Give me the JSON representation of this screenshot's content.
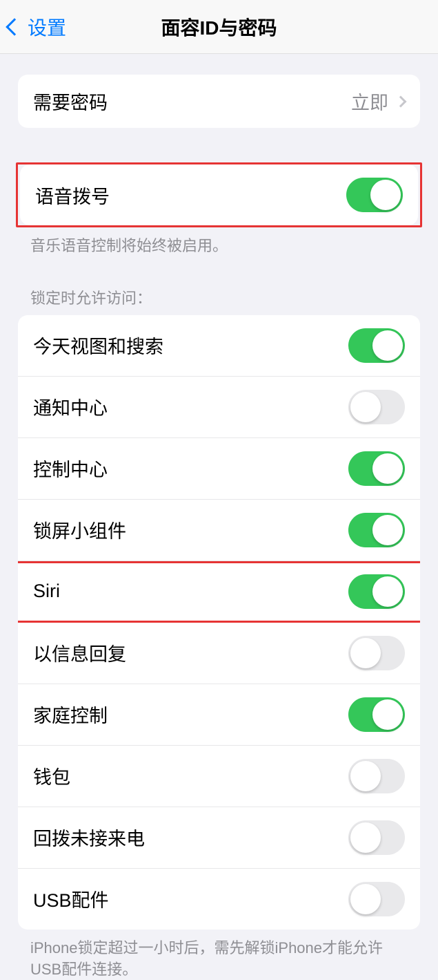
{
  "header": {
    "back_label": "设置",
    "title": "面容ID与密码"
  },
  "passcode": {
    "require_label": "需要密码",
    "require_value": "立即"
  },
  "voice_dial": {
    "label": "语音拨号",
    "on": true,
    "footer": "音乐语音控制将始终被启用。"
  },
  "allow_access": {
    "header": "锁定时允许访问：",
    "items": [
      {
        "label": "今天视图和搜索",
        "on": true
      },
      {
        "label": "通知中心",
        "on": false
      },
      {
        "label": "控制中心",
        "on": true
      },
      {
        "label": "锁屏小组件",
        "on": true
      },
      {
        "label": "Siri",
        "on": true
      },
      {
        "label": "以信息回复",
        "on": false
      },
      {
        "label": "家庭控制",
        "on": true
      },
      {
        "label": "钱包",
        "on": false
      },
      {
        "label": "回拨未接来电",
        "on": false
      },
      {
        "label": "USB配件",
        "on": false
      }
    ],
    "footer": "iPhone锁定超过一小时后，需先解锁iPhone才能允许USB配件连接。"
  }
}
